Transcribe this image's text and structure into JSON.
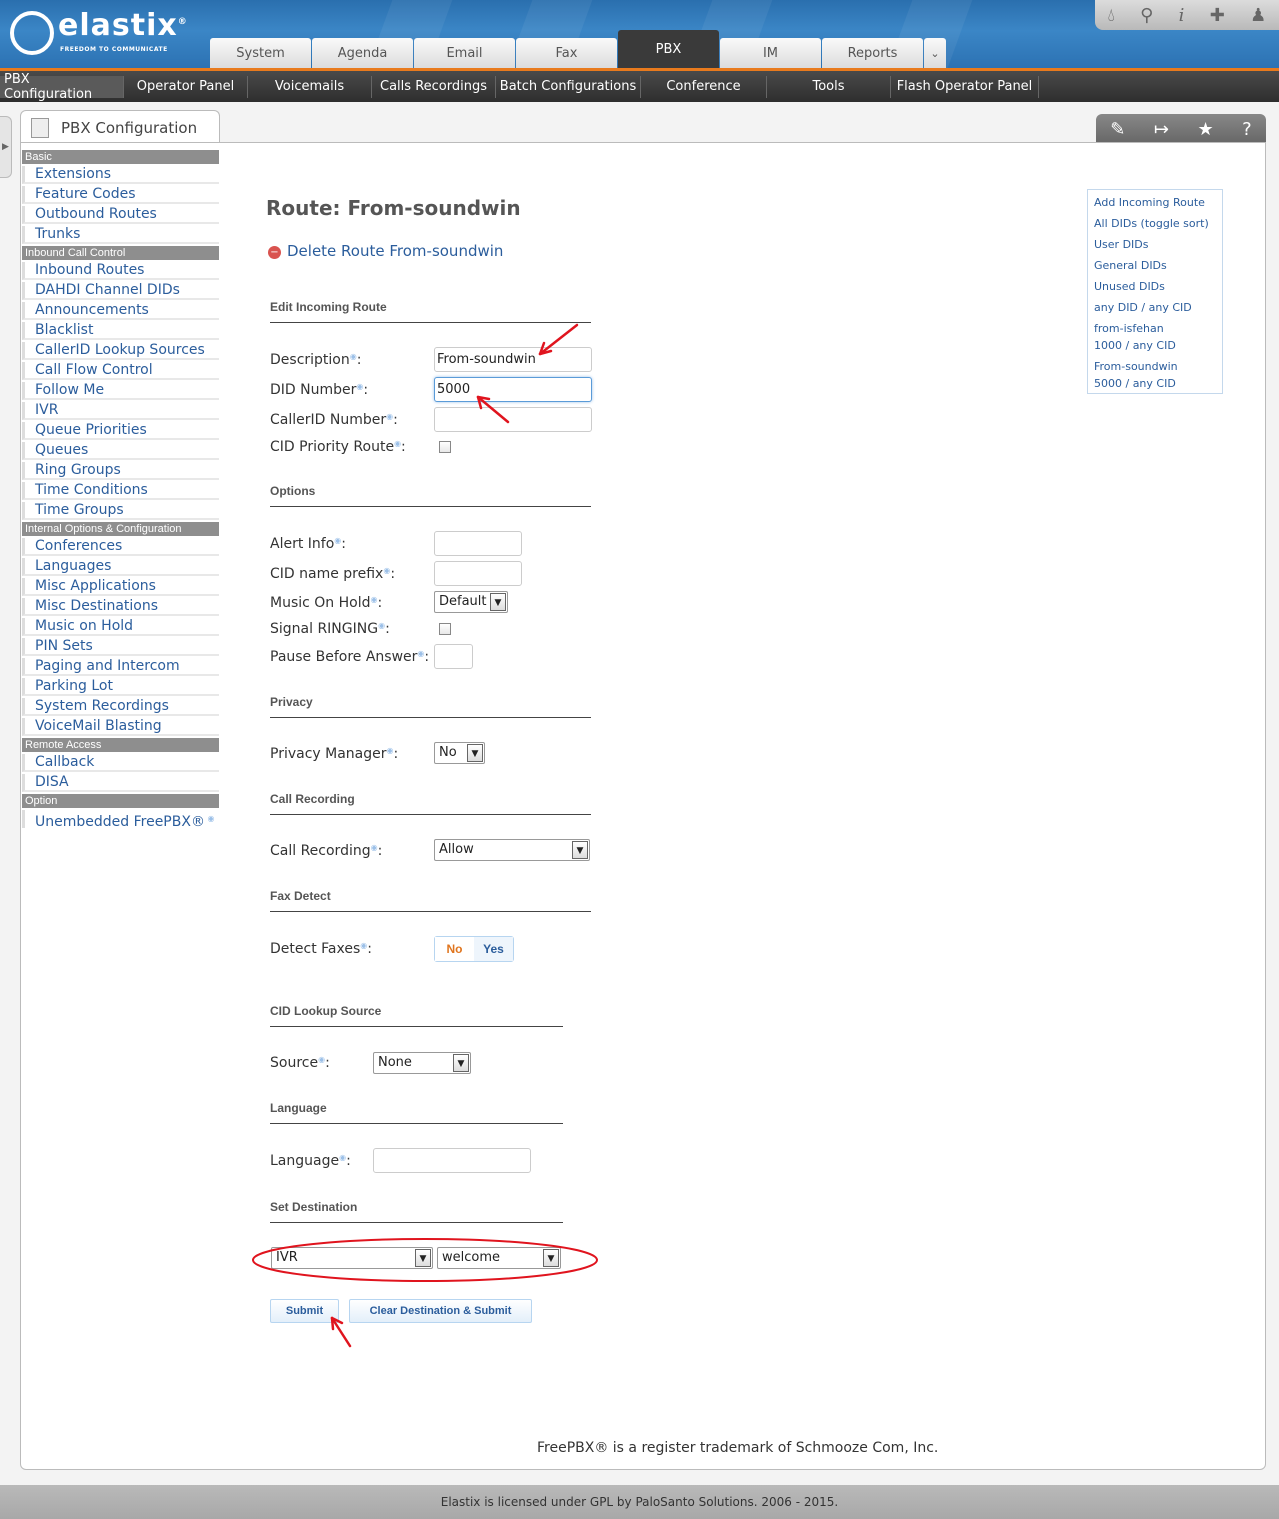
{
  "brand": {
    "name": "elastix",
    "registered": "®",
    "tagline": "FREEDOM TO COMMUNICATE"
  },
  "topicons": [
    "drop-icon",
    "search-icon",
    "info-icon",
    "puzzle-icon",
    "user-icon"
  ],
  "tabs": [
    "System",
    "Agenda",
    "Email",
    "Fax",
    "PBX",
    "IM",
    "Reports"
  ],
  "active_tab": "PBX",
  "tab_more": "⌄",
  "subnav": [
    "PBX Configuration",
    "Operator Panel",
    "Voicemails",
    "Calls Recordings",
    "Batch Configurations",
    "Conference",
    "Tools",
    "Flash Operator Panel"
  ],
  "panel_title": "PBX Configuration",
  "side": {
    "basic": "Basic",
    "basic_items": [
      "Extensions",
      "Feature Codes",
      "Outbound Routes",
      "Trunks"
    ],
    "inbound": "Inbound Call Control",
    "inbound_items": [
      "Inbound Routes",
      "DAHDI Channel DIDs",
      "Announcements",
      "Blacklist",
      "CallerID Lookup Sources",
      "Call Flow Control",
      "Follow Me",
      "IVR",
      "Queue Priorities",
      "Queues",
      "Ring Groups",
      "Time Conditions",
      "Time Groups"
    ],
    "internal": "Internal Options & Configuration",
    "internal_items": [
      "Conferences",
      "Languages",
      "Misc Applications",
      "Misc Destinations",
      "Music on Hold",
      "PIN Sets",
      "Paging and Intercom",
      "Parking Lot",
      "System Recordings",
      "VoiceMail Blasting"
    ],
    "remote": "Remote Access",
    "remote_items": [
      "Callback",
      "DISA"
    ],
    "option": "Option",
    "option_items": [
      "Unembedded FreePBX®"
    ]
  },
  "form": {
    "title": "Route: From-soundwin",
    "delete_link": "Delete Route From-soundwin",
    "sections": {
      "edit": "Edit Incoming Route",
      "options": "Options",
      "privacy": "Privacy",
      "callrec": "Call Recording",
      "fax": "Fax Detect",
      "cid": "CID Lookup Source",
      "language": "Language",
      "dest": "Set Destination"
    },
    "labels": {
      "description": "Description",
      "did": "DID Number",
      "callerid": "CallerID Number",
      "cidpriority": "CID Priority Route",
      "alertinfo": "Alert Info",
      "cidprefix": "CID name prefix",
      "moh": "Music On Hold",
      "signal": "Signal RINGING",
      "pause": "Pause Before Answer",
      "privacy": "Privacy Manager",
      "callrecording": "Call Recording",
      "detectfaxes": "Detect Faxes",
      "source": "Source",
      "language": "Language"
    },
    "values": {
      "description": "From-soundwin",
      "did": "5000",
      "callerid": "",
      "alertinfo": "",
      "cidprefix": "",
      "moh": "Default",
      "pause": "",
      "privacy": "No",
      "callrecording": "Allow",
      "fax_no": "No",
      "fax_yes": "Yes",
      "source": "None",
      "language": "",
      "dest_type": "IVR",
      "dest_value": "welcome"
    },
    "buttons": {
      "submit": "Submit",
      "clear": "Clear Destination & Submit"
    }
  },
  "right_menu": [
    "Add Incoming Route",
    "All DIDs (toggle sort)",
    "User DIDs",
    "General DIDs",
    "Unused DIDs",
    "any DID / any CID",
    "from-isfehan",
    "1000 / any CID",
    "From-soundwin",
    "5000 / any CID"
  ],
  "footer_trademark": "FreePBX® is a register trademark of Schmooze Com, Inc.",
  "footer_license": "Elastix is licensed under GPL by PaloSanto Solutions. 2006 - 2015.",
  "colors": {
    "accent": "#e87a1d",
    "link": "#2b5d9c",
    "annotation": "#e0141e"
  }
}
